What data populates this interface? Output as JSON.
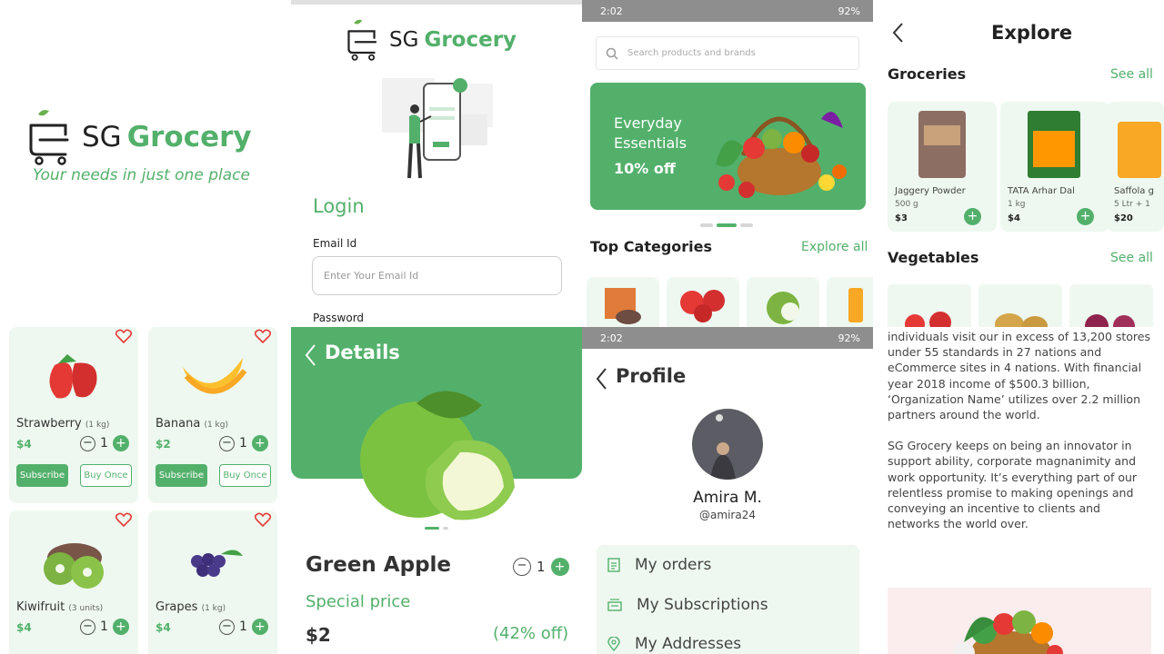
{
  "splash": {
    "brand_sg": "SG",
    "brand_grocery": "Grocery",
    "tagline": "Your needs in just one place"
  },
  "login": {
    "brand_sg": "SG",
    "brand_grocery": "Grocery",
    "title": "Login",
    "email_label": "Email Id",
    "email_placeholder": "Enter Your Email Id",
    "password_label": "Password"
  },
  "home": {
    "status_time": "2:02",
    "status_battery": "92%",
    "search_placeholder": "Search products and brands",
    "banner_title": "Everyday Essentials",
    "banner_discount": "10% off",
    "categories_title": "Top Categories",
    "categories_link": "Explore all"
  },
  "explore": {
    "title": "Explore",
    "groceries_title": "Groceries",
    "vegetables_title": "Vegetables",
    "see_all": "See all",
    "products": [
      {
        "name": "Jaggery Powder",
        "qty": "500 g",
        "price": "$3"
      },
      {
        "name": "TATA Arhar Dal",
        "qty": "1 kg",
        "price": "$4"
      },
      {
        "name": "Saffola g",
        "qty": "5 Ltr + 1",
        "price": "$20"
      }
    ]
  },
  "list": {
    "fruits": [
      {
        "name": "Strawberry",
        "unit": "(1 kg)",
        "price": "$4",
        "count": "1"
      },
      {
        "name": "Banana",
        "unit": "(1 kg)",
        "price": "$2",
        "count": "1"
      },
      {
        "name": "Kiwifruit",
        "unit": "(3 units)",
        "price": "$4",
        "count": "1"
      },
      {
        "name": "Grapes",
        "unit": "(1 kg)",
        "price": "$4",
        "count": "1"
      }
    ],
    "subscribe_label": "Subscribe",
    "buy_once_label": "Buy Once"
  },
  "details": {
    "title": "Details",
    "product": "Green Apple",
    "count": "1",
    "special_price": "Special price",
    "price": "$2",
    "discount": "(42% off)"
  },
  "profile": {
    "status_time": "2:02",
    "status_battery": "92%",
    "title": "Profile",
    "name": "Amira M.",
    "handle": "@amira24",
    "menu": [
      "My orders",
      "My Subscriptions",
      "My Addresses"
    ]
  },
  "about": {
    "paragraph1": "individuals visit our in excess of 13,200 stores under 55 standards in 27 nations and eCommerce sites in 4 nations. With financial year 2018 income of $500.3 billion, ‘Organization Name’ utilizes over 2.2 million partners around the world.",
    "paragraph2": "SG Grocery keeps on being an innovator in support ability, corporate magnanimity and work opportunity. It’s everything part of our relentless promise to making openings and conveying an incentive to clients and networks the world over."
  },
  "colors": {
    "accent": "#53b06b",
    "tile": "#eef8f0"
  }
}
